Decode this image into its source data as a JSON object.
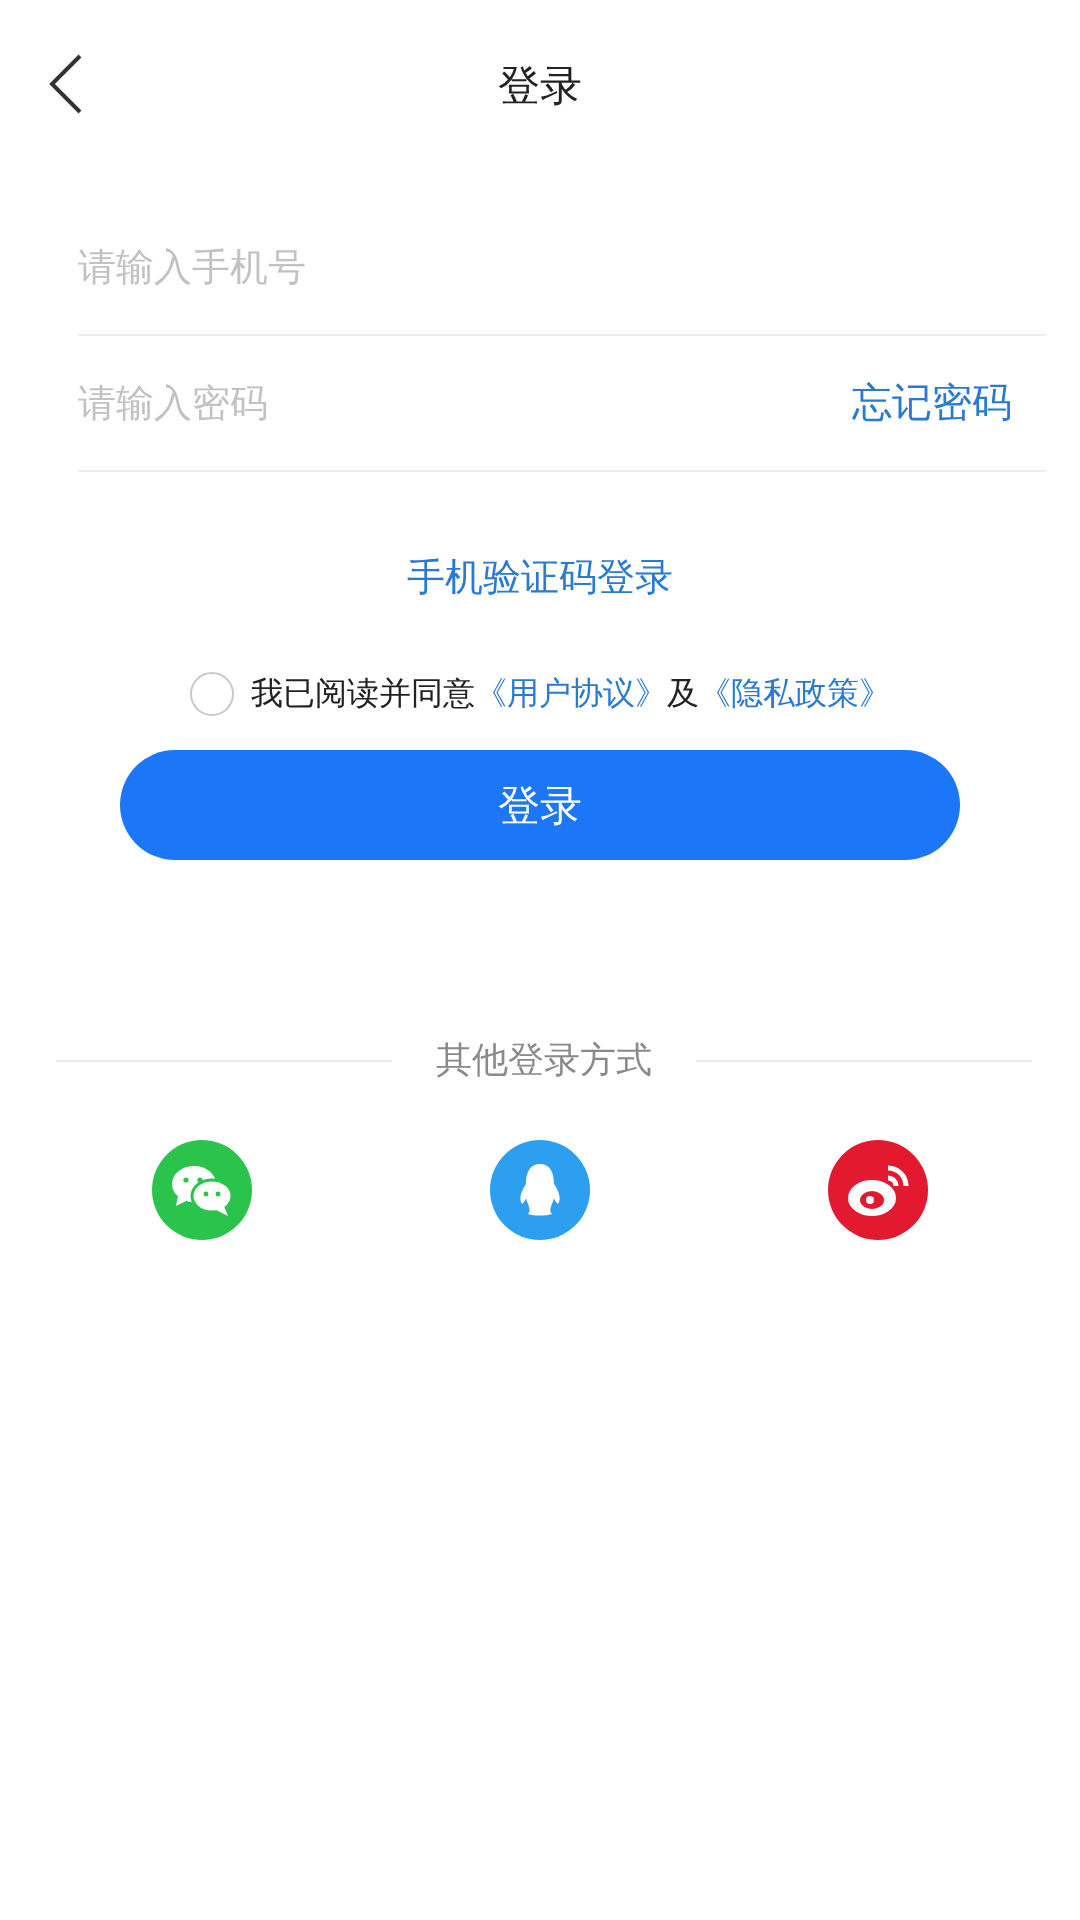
{
  "header": {
    "title": "登录"
  },
  "fields": [
    {
      "placeholder": "请输入手机号"
    },
    {
      "placeholder": "请输入密码",
      "action": "忘记密码"
    }
  ],
  "sms_login_link": "手机验证码登录",
  "agreement": {
    "checked": false,
    "parts": [
      {
        "kind": "text",
        "text": "我已阅读并同意"
      },
      {
        "kind": "link",
        "text": "《用户协议》"
      },
      {
        "kind": "text",
        "text": "及"
      },
      {
        "kind": "link",
        "text": "《隐私政策》"
      }
    ]
  },
  "login_button": "登录",
  "other_login": {
    "title": "其他登录方式",
    "options": [
      {
        "kind": "chat",
        "color": "#2ac34b"
      },
      {
        "kind": "penguin",
        "color": "#2d9ff0"
      },
      {
        "kind": "swirl",
        "color": "#e3192f"
      }
    ]
  }
}
